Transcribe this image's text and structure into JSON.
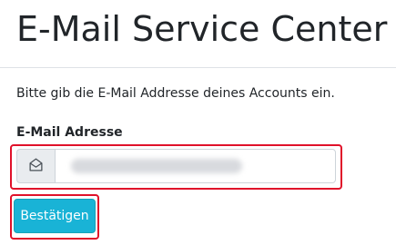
{
  "page": {
    "title": "E-Mail Service Center",
    "intro": "Bitte gib die E-Mail Addresse deines Accounts ein."
  },
  "form": {
    "email_label": "E-Mail Adresse",
    "email_value": "",
    "email_icon": "envelope-open-icon",
    "submit_label": "Bestätigen"
  },
  "colors": {
    "highlight": "#e0112a",
    "button": "#19b3d6",
    "button_text": "#ffffff",
    "input_addon": "#e9ecef"
  }
}
